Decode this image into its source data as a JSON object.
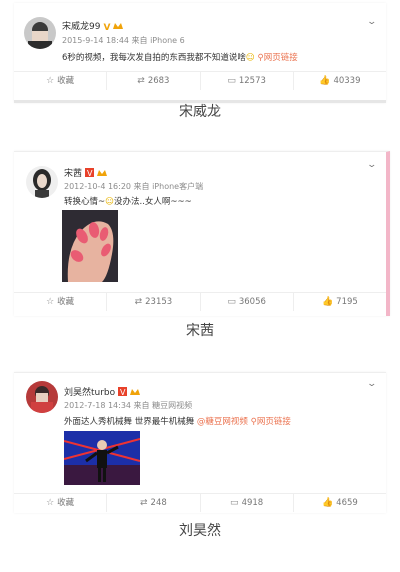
{
  "posts": [
    {
      "name": "宋威龙99",
      "meta": "2015-9-14 18:44 来自 iPhone 6",
      "text": "6秒的视频，我每次发自拍的东西我都不知道说啥",
      "link_text": "网页链接",
      "actions": {
        "fav": "收藏",
        "repost": "2683",
        "comment": "12573",
        "like": "40339"
      },
      "caption": "宋威龙"
    },
    {
      "name": "宋茜",
      "meta": "2012-10-4 16:20 来自 iPhone客户端",
      "text": "转换心情~",
      "text2": "没办法..女人啊~~~",
      "actions": {
        "fav": "收藏",
        "repost": "23153",
        "comment": "36056",
        "like": "7195"
      },
      "caption": "宋茜"
    },
    {
      "name": "刘昊然turbo",
      "meta": "2012-7-18 14:34 来自 糖豆网视频",
      "text": "外面达人秀机械舞 世界最牛机械舞",
      "mention": "@糖豆网视频",
      "link_text": "网页链接",
      "actions": {
        "fav": "收藏",
        "repost": "248",
        "comment": "4918",
        "like": "4659"
      },
      "caption": "刘昊然"
    }
  ],
  "icons": {
    "star": "star-icon",
    "repost": "repost-icon",
    "comment": "comment-icon",
    "like": "like-icon",
    "chevron": "chevron-down-icon",
    "link": "link-icon"
  },
  "colors": {
    "link": "#eb7350",
    "vip": "#f0a30a",
    "verify_red": "#e8412a",
    "pink_border": "#f3b6c8"
  }
}
